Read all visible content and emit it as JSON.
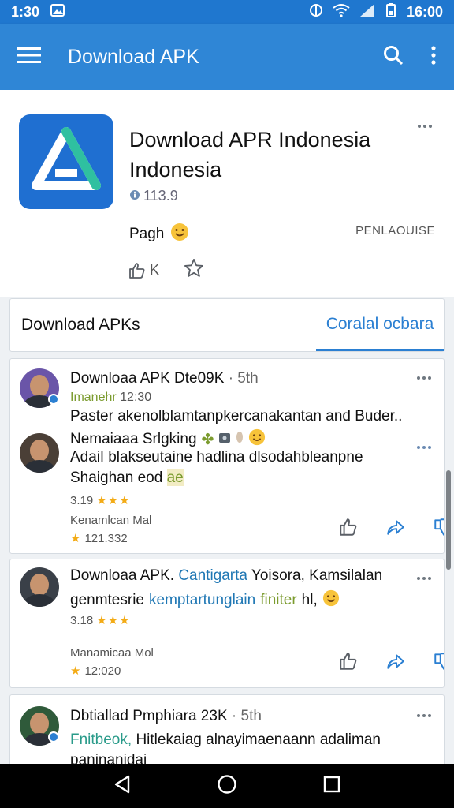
{
  "status": {
    "time_left": "1:30",
    "time_right": "16:00"
  },
  "appbar": {
    "title": "Download APK"
  },
  "header": {
    "title": "Download APR Indonesia Indonesia",
    "meta": "113.9",
    "page": "Pagh",
    "tag": "PENLAOUISE",
    "like_label": "K"
  },
  "tabs": {
    "primary": "Download  APKs",
    "secondary": "Coralal ocbara"
  },
  "posts": [
    {
      "title": "Downloaa APK Dte09K",
      "time": "· 5th",
      "sub_a": "Imanehr",
      "sub_b": "12:30",
      "body": "Paster akenolblamtanpkercanakantan and Buder.."
    },
    {
      "title": "Nemaiaaa Srlgking",
      "body_a": "Adaiǀ blakseutaine hadlina dlsodahbleanpne",
      "body_b": "Shaighan eod",
      "body_b_accent": "ae",
      "rating_a": "3.19",
      "rating_b": "Kenamlcan Mal",
      "count": "121.332"
    },
    {
      "title_a": "Downloaa APK.",
      "title_accent": "Cantigarta",
      "title_b": "Yoisora, Kamsilalan",
      "line2_a": "genmtesrie",
      "line2_accent": "kemptartunglain",
      "line2_green": "finiter",
      "line2_b": "hl,",
      "rating_a": "3.18",
      "rating_b": "Manamicaa Mol",
      "count": "12:020"
    },
    {
      "title": "Dbtiallad Pmphiara 23K",
      "time": "· 5th",
      "sub_a": "Fnitbeok,",
      "sub_b": "Hitlekaiag alnayimaenaann adaliman",
      "sub_c": "paninanidai"
    }
  ],
  "colors": {
    "primary": "#2f86d6",
    "accent": "#2a7fd2",
    "star": "#f3ab16"
  }
}
